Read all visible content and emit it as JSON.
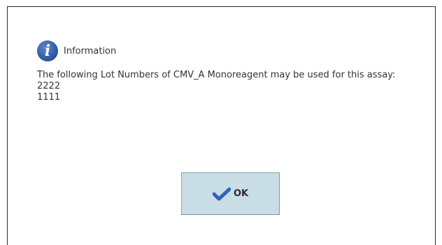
{
  "dialog": {
    "title": "Information",
    "message_lines": [
      "The following Lot Numbers of CMV_A Monoreagent may be used for this assay:",
      "2222",
      "1111"
    ],
    "ok_label": "OK"
  },
  "icons": {
    "info": "info-icon",
    "check": "checkmark-icon"
  },
  "colors": {
    "button_bg": "#c9dde6",
    "info_icon": "#2f5aa6",
    "check": "#2f65b5"
  }
}
